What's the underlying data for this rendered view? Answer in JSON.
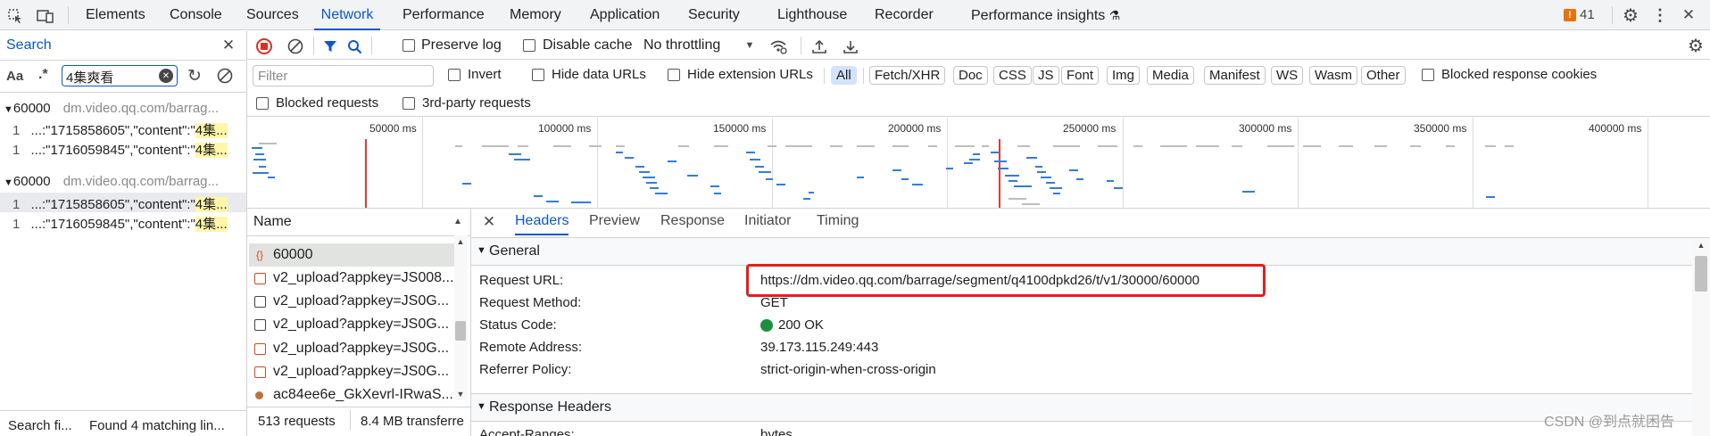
{
  "toolbar": {
    "tabs": [
      "Elements",
      "Console",
      "Sources",
      "Network",
      "Performance",
      "Memory",
      "Application",
      "Security",
      "Lighthouse",
      "Recorder",
      "Performance insights"
    ],
    "active_tab": "Network",
    "issues_count": "41"
  },
  "search": {
    "title": "Search",
    "case_label": "Aa",
    "regex_label": ".*",
    "query": "4集爽看",
    "groups": [
      {
        "name": "60000",
        "url": "dm.video.qq.com/barrag...",
        "results": [
          {
            "line": "1",
            "pre": "...:\"1715858605\",\"content\":\"",
            "match": "4集..."
          },
          {
            "line": "1",
            "pre": "...:\"1716059845\",\"content\":\"",
            "match": "4集..."
          }
        ]
      },
      {
        "name": "60000",
        "url": "dm.video.qq.com/barrag...",
        "results": [
          {
            "line": "1",
            "pre": "...:\"1715858605\",\"content\":\"",
            "match": "4集..."
          },
          {
            "line": "1",
            "pre": "...:\"1716059845\",\"content\":\"",
            "match": "4集..."
          }
        ]
      }
    ],
    "status_left": "Search fi...",
    "status_right": "Found 4 matching lin..."
  },
  "network": {
    "preserve_log": "Preserve log",
    "disable_cache": "Disable cache",
    "throttling": "No throttling",
    "filter_placeholder": "Filter",
    "invert": "Invert",
    "hide_data_urls": "Hide data URLs",
    "hide_extension_urls": "Hide extension URLs",
    "types": [
      "All",
      "Fetch/XHR",
      "Doc",
      "CSS",
      "JS",
      "Font",
      "Img",
      "Media",
      "Manifest",
      "WS",
      "Wasm",
      "Other"
    ],
    "blocked_response_cookies": "Blocked response cookies",
    "blocked_requests": "Blocked requests",
    "third_party": "3rd-party requests",
    "ticks": [
      "50000 ms",
      "100000 ms",
      "150000 ms",
      "200000 ms",
      "250000 ms",
      "300000 ms",
      "350000 ms",
      "400000 ms"
    ],
    "name_header": "Name",
    "requests": [
      {
        "name": "60000",
        "kind": "xhr"
      },
      {
        "name": "v2_upload?appkey=JS008...",
        "kind": "xhr"
      },
      {
        "name": "v2_upload?appkey=JS0G...",
        "kind": "doc"
      },
      {
        "name": "v2_upload?appkey=JS0G...",
        "kind": "doc"
      },
      {
        "name": "v2_upload?appkey=JS0G...",
        "kind": "xhr"
      },
      {
        "name": "v2_upload?appkey=JS0G...",
        "kind": "xhr"
      },
      {
        "name": "ac84ee6e_GkXevrl-IRwaS...",
        "kind": "img"
      }
    ],
    "summary_requests": "513 requests",
    "summary_transfer": "8.4 MB transferre"
  },
  "details": {
    "tabs": [
      "Headers",
      "Preview",
      "Response",
      "Initiator",
      "Timing"
    ],
    "active_tab": "Headers",
    "general_title": "General",
    "general": [
      {
        "key": "Request URL:",
        "value": "https://dm.video.qq.com/barrage/segment/q4100dpkd26/t/v1/30000/60000"
      },
      {
        "key": "Request Method:",
        "value": "GET"
      },
      {
        "key": "Status Code:",
        "value": "200 OK"
      },
      {
        "key": "Remote Address:",
        "value": "39.173.115.249:443"
      },
      {
        "key": "Referrer Policy:",
        "value": "strict-origin-when-cross-origin"
      }
    ],
    "response_headers_title": "Response Headers",
    "partial_key": "Accept-Ranges:",
    "partial_value": "bytes"
  },
  "watermark": "CSDN @到点就困告",
  "colors": {
    "accent": "#0b57d0",
    "status_ok": "#1e8e3e",
    "highlight_box": "#e0201b",
    "record": "#d93025"
  }
}
